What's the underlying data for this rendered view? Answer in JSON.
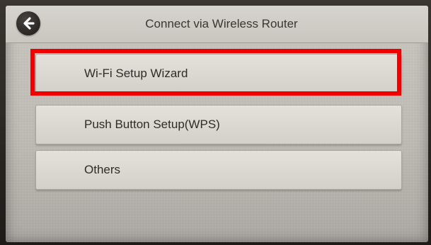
{
  "header": {
    "title": "Connect via Wireless Router",
    "back_icon": "back-arrow-icon"
  },
  "menu": {
    "items": [
      {
        "label": "Wi-Fi Setup Wizard",
        "highlighted": true
      },
      {
        "label": "Push Button Setup(WPS)",
        "highlighted": false
      },
      {
        "label": "Others",
        "highlighted": false
      }
    ]
  },
  "colors": {
    "highlight": "#f00000",
    "screen_background": "#c2beb8",
    "button_background": "#dcd8d2",
    "text": "#2f2c29"
  }
}
